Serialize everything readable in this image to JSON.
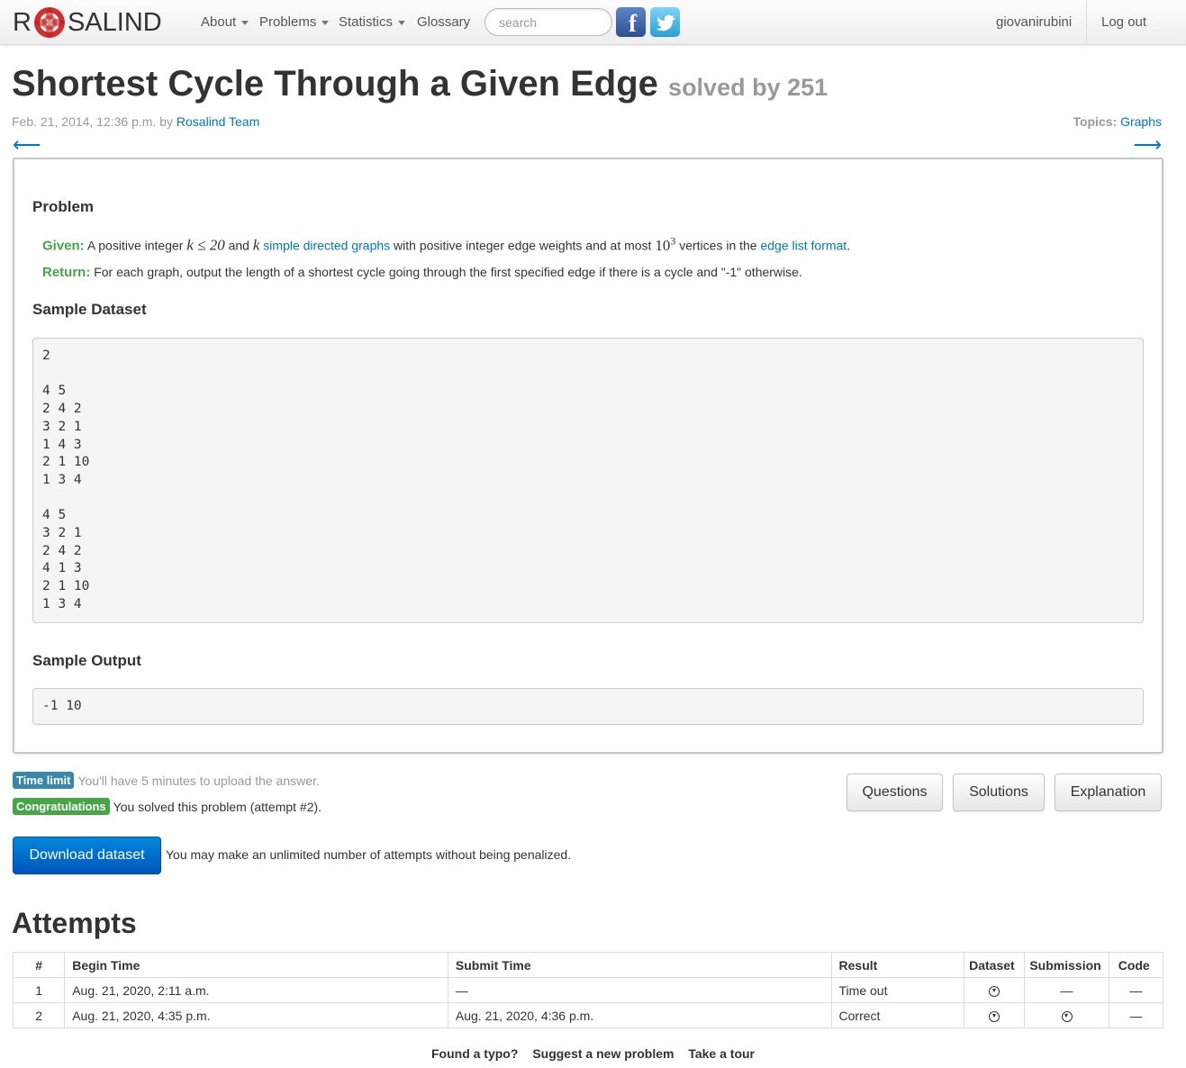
{
  "nav": {
    "brand_left": "R",
    "brand_right": "SALIND",
    "about": "About",
    "problems": "Problems",
    "statistics": "Statistics",
    "glossary": "Glossary",
    "search_placeholder": "search",
    "facebook": "f",
    "username": "giovanirubini",
    "logout": "Log out"
  },
  "problem": {
    "title": "Shortest Cycle Through a Given Edge",
    "solved_by": "solved by 251",
    "date_by": "Feb. 21, 2014, 12:36 p.m. by",
    "author": "Rosalind Team",
    "topics_label": "Topics:",
    "topic": "Graphs",
    "prev_arrow": "⟵",
    "next_arrow": "⟶"
  },
  "content": {
    "problem_heading": "Problem",
    "given_label": "Given:",
    "given_text_1": "A positive integer",
    "given_math_1": "k ≤ 20",
    "given_text_2": "and",
    "given_math_2": "k",
    "given_link_1": "simple directed graphs",
    "given_text_3": "with positive integer edge weights and at most",
    "given_math_3_base": "10",
    "given_math_3_exp": "3",
    "given_text_4": "vertices in the",
    "given_link_2": "edge list format",
    "given_text_5": ".",
    "return_label": "Return:",
    "return_text": "For each graph, output the length of a shortest cycle going through the first specified edge if there is a cycle and \"-1\" otherwise.",
    "sample_dataset_heading": "Sample Dataset",
    "sample_dataset": "2\n\n4 5\n2 4 2\n3 2 1\n1 4 3\n2 1 10\n1 3 4\n\n4 5\n3 2 1\n2 4 2\n4 1 3\n2 1 10\n1 3 4",
    "sample_output_heading": "Sample Output",
    "sample_output": "-1 10"
  },
  "status": {
    "time_limit_badge": "Time limit",
    "time_limit_text": "You'll have 5 minutes to upload the answer.",
    "congrats_badge": "Congratulations",
    "congrats_text": "You solved this problem (attempt #2).",
    "download_button": "Download dataset",
    "unlimited_text": "You may make an unlimited number of attempts without being penalized.",
    "questions_button": "Questions",
    "solutions_button": "Solutions",
    "explanation_button": "Explanation"
  },
  "attempts": {
    "title": "Attempts",
    "headers": [
      "#",
      "Begin Time",
      "Submit Time",
      "Result",
      "Dataset",
      "Submission",
      "Code"
    ],
    "rows": [
      {
        "num": "1",
        "begin": "Aug. 21, 2020, 2:11 a.m.",
        "submit": "—",
        "result": "Time out",
        "submission": "—",
        "code": "—"
      },
      {
        "num": "2",
        "begin": "Aug. 21, 2020, 4:35 p.m.",
        "submit": "Aug. 21, 2020, 4:36 p.m.",
        "result": "Correct",
        "submission": "download",
        "code": "—"
      }
    ]
  },
  "footer": {
    "typo": "Found a typo?",
    "suggest": "Suggest a new problem",
    "tour": "Take a tour"
  },
  "colors": {
    "link": "#0077cc",
    "green_label": "#46a546",
    "time_limit_badge": "#3a87ad",
    "primary_button": "#0066cc"
  }
}
